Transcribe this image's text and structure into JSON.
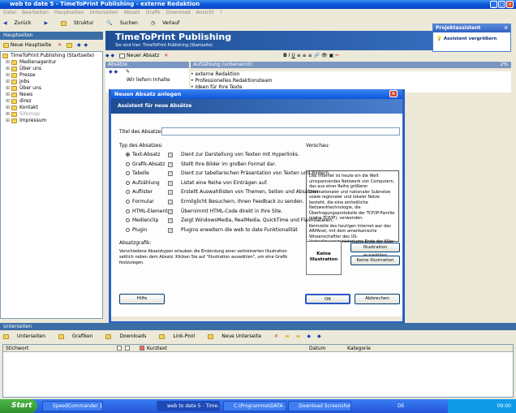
{
  "window": {
    "title": "web to date 5 - TimeToPrint Publishing - externe Redaktion"
  },
  "menu": [
    "Datei",
    "Bearbeiten",
    "Hauptseiten",
    "Unterseiten",
    "Absatz",
    "Grafik",
    "Download",
    "Ansicht",
    "?"
  ],
  "toolbar": {
    "back": "Zurück",
    "struktur": "Struktur",
    "suchen": "Suchen",
    "verlauf": "Verlauf"
  },
  "left": {
    "header": "Hauptseiten",
    "new_button": "Neue Hauptseite",
    "tree": [
      {
        "label": "TimeToPrint Publishing (Startseite)",
        "level": 0
      },
      {
        "label": "Medienagentur",
        "level": 1
      },
      {
        "label": "Über uns",
        "level": 1
      },
      {
        "label": "Presse",
        "level": 1
      },
      {
        "label": "Jobs",
        "level": 1
      },
      {
        "label": "Über uns",
        "level": 1
      },
      {
        "label": "News",
        "level": 1
      },
      {
        "label": "direz",
        "level": 1
      },
      {
        "label": "Kontakt",
        "level": 1
      },
      {
        "label": "Sitemap",
        "level": 1
      },
      {
        "label": "Impressum",
        "level": 1
      }
    ]
  },
  "banner": {
    "title": "TimeToPrint Publishing",
    "subtitle": "Sie sind hier: TimeToPrint Publishing (Startseite)"
  },
  "content": {
    "new_section": "Neuer Absatz",
    "sections_label": "Absätze",
    "list_label": "Aufzählung (unbenannt)",
    "percent": "2%",
    "list_items": [
      "• externe Redaktion",
      "• Professionelles Redaktionsteam",
      "• Ideen für Ihre Texte"
    ],
    "first_section": "Wir liefern Inhalte"
  },
  "assistant": {
    "title": "Projektassistent",
    "link": "Assistent vergrößern"
  },
  "dialog": {
    "title": "Neuen Absatz anlegen",
    "header": "Assistent für neue Absätze",
    "title_label": "Titel des Absatzes:",
    "type_label": "Typ des Absatzes:",
    "preview_label": "Vorschau:",
    "grafik_label": "Absatzgrafik:",
    "options": [
      {
        "label": "Text-Absatz",
        "desc": "Dient zur Darstellung von Texten mit Hyperlinks.",
        "selected": true
      },
      {
        "label": "Grafik-Absatz",
        "desc": "Stellt Ihre Bilder im großen Format dar.",
        "selected": false
      },
      {
        "label": "Tabelle",
        "desc": "Dient zur tabellarischen Präsentation von Texten und Bildern.",
        "selected": false
      },
      {
        "label": "Aufzählung",
        "desc": "Listet eine Reihe von Einträgen auf.",
        "selected": false
      },
      {
        "label": "Auflister",
        "desc": "Erstellt Auswahllisten von Themen, Seiten und Absätzen.",
        "selected": false
      },
      {
        "label": "Formular",
        "desc": "Ermöglicht Besuchern, Ihnen Feedback zu senden.",
        "selected": false
      },
      {
        "label": "HTML-Element",
        "desc": "Übernimmt HTML-Code direkt in Ihre Site.",
        "selected": false
      },
      {
        "label": "Medienclip",
        "desc": "Zeigt WindowsMedia, RealMedia, QuickTime und Flashdateien.",
        "selected": false
      },
      {
        "label": "Plugin",
        "desc": "Plugins erweitern die web to date Funktionalität",
        "selected": false
      }
    ],
    "preview_p1": "Das Internet ist heute ein die Welt umspannendes Netzwerk von Computern, das aus einer Reihe größerer internationaler und nationaler Subnetze sowie regionaler und lokaler Netze besteht, die eine einheitliche Netzwerktechnologie, die Übertragungsprotokolle der TCP/IP-Familie (siehe TCP/IP), verwenden.",
    "preview_p2": "Keimzelle des heutigen Internet war das ARPAnet, mit dem amerikanische Wissenschaftler des US-Verteidigungsministeriums Ende der 60er-Jahre",
    "grafik_text": "Verschiedene Absatztypen erlauben die Einbindung einer verkleinerten Illustration seitlich neben dem Absatz. Klicken Sie auf \"Illustration auswählen\", um eine Grafik festzulegen.",
    "no_illustration": "Keine Illustration",
    "btn_choose": "Illustration auswählen",
    "btn_none": "Keine Illustration",
    "btn_help": "Hilfe",
    "btn_ok": "OK",
    "btn_cancel": "Abbrechen"
  },
  "bottom": {
    "header": "Unterseiten",
    "tools": [
      "Unterseiten",
      "Grafiken",
      "Downloads",
      "Link-Pool",
      "Neue Unterseite"
    ],
    "columns": [
      "Stichwort",
      "Kurztext",
      "Datum",
      "Kategorie"
    ]
  },
  "taskbar": {
    "start": "Start",
    "tasks": [
      "SpeedCommander 10",
      "web to date 5 - Time...",
      "C:\\Programme\\DATA ...",
      "Download Screenshot..."
    ],
    "lang": "DE",
    "time": "09:00"
  }
}
